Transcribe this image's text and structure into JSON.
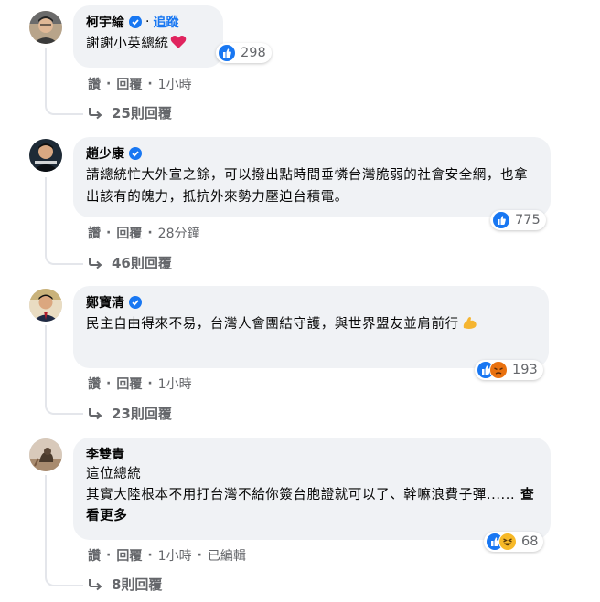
{
  "comments": [
    {
      "name": "柯宇綸",
      "follow": "追蹤",
      "text": "謝謝小英總統",
      "reactions": "298",
      "actions": {
        "like": "讚",
        "reply": "回覆",
        "time": "1小時"
      },
      "replies": "25則回覆"
    },
    {
      "name": "趙少康",
      "text": "請總統忙大外宣之餘，可以撥出點時間垂憐台灣脆弱的社會安全網，也拿出該有的魄力，抵抗外來勢力壓迫台積電。",
      "reactions": "775",
      "actions": {
        "like": "讚",
        "reply": "回覆",
        "time": "28分鐘"
      },
      "replies": "46則回覆"
    },
    {
      "name": "鄭寶清",
      "text": "民主自由得來不易，台灣人會團結守護，與世界盟友並肩前行",
      "reactions": "193",
      "actions": {
        "like": "讚",
        "reply": "回覆",
        "time": "1小時"
      },
      "replies": "23則回覆"
    },
    {
      "name": "李雙貴",
      "text_line1": "這位總統",
      "text": "其實大陸根本不用打台灣不給你簽台胞證就可以了、幹嘛浪費子彈......",
      "see_more": "查看更多",
      "reactions": "68",
      "actions": {
        "like": "讚",
        "reply": "回覆",
        "time": "1小時",
        "edited": "已編輯"
      },
      "replies": "8則回覆"
    }
  ],
  "colors": {
    "link": "#1877f2",
    "bubble": "#f0f2f5",
    "meta": "#65676b"
  },
  "icons": [
    "verified-badge-icon",
    "heart-emoji-icon",
    "flexed-biceps-emoji-icon",
    "like-reaction-icon",
    "angry-reaction-icon",
    "haha-reaction-icon",
    "reply-arrow-icon"
  ]
}
